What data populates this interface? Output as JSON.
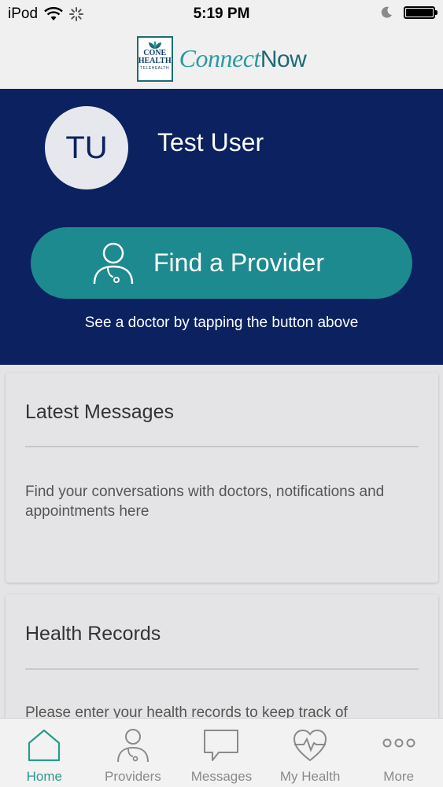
{
  "status_bar": {
    "carrier": "iPod",
    "time": "5:19 PM"
  },
  "header": {
    "logo_line1": "CONE",
    "logo_line2": "HEALTH",
    "logo_sub": "TELEHEALTH",
    "brand_part1": "Connect",
    "brand_part2": "Now"
  },
  "profile": {
    "initials": "TU",
    "name": "Test User"
  },
  "find_provider": {
    "label": "Find a Provider",
    "hint": "See a doctor by tapping the button above"
  },
  "cards": [
    {
      "title": "Latest Messages",
      "body": "Find your conversations with doctors, notifications and appointments here"
    },
    {
      "title": "Health Records",
      "body": "Please enter your health records to keep track of"
    }
  ],
  "tabs": [
    {
      "label": "Home",
      "icon": "home-icon",
      "active": true
    },
    {
      "label": "Providers",
      "icon": "person-icon",
      "active": false
    },
    {
      "label": "Messages",
      "icon": "chat-icon",
      "active": false
    },
    {
      "label": "My Health",
      "icon": "heart-icon",
      "active": false
    },
    {
      "label": "More",
      "icon": "more-icon",
      "active": false
    }
  ],
  "colors": {
    "hero_background": "#0b2160",
    "accent": "#1c8a8e",
    "tab_active": "#2a9a8e"
  }
}
